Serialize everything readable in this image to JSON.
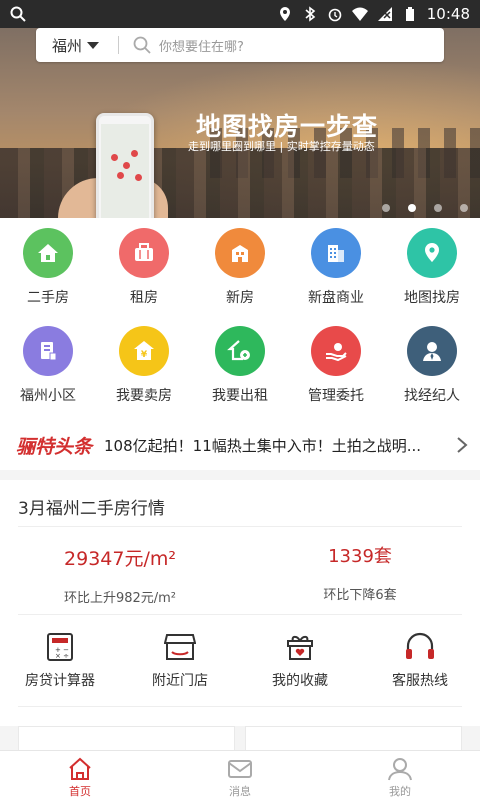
{
  "status_bar": {
    "time": "10:48"
  },
  "search": {
    "city": "福州",
    "placeholder": "你想要住在哪?"
  },
  "banner": {
    "title": "地图找房一步查",
    "subtitle": "走到哪里圈到哪里 | 实时掌控存量动态",
    "slide_count": 4,
    "active_slide": 2
  },
  "grid": {
    "row1": [
      {
        "label": "二手房",
        "icon": "house-icon",
        "color": "#5cc25f"
      },
      {
        "label": "租房",
        "icon": "suitcase-icon",
        "color": "#f06a6a"
      },
      {
        "label": "新房",
        "icon": "building-icon",
        "color": "#f08a3c"
      },
      {
        "label": "新盘商业",
        "icon": "office-icon",
        "color": "#4a90e2"
      },
      {
        "label": "地图找房",
        "icon": "map-pin-icon",
        "color": "#2ec4a6"
      }
    ],
    "row2": [
      {
        "label": "福州小区",
        "icon": "community-icon",
        "color": "#8a7ce0"
      },
      {
        "label": "我要卖房",
        "icon": "sell-icon",
        "color": "#f5c518"
      },
      {
        "label": "我要出租",
        "icon": "rent-out-icon",
        "color": "#2eb85c"
      },
      {
        "label": "管理委托",
        "icon": "hand-icon",
        "color": "#e84a4a"
      },
      {
        "label": "找经纪人",
        "icon": "agent-icon",
        "color": "#3e5f7a"
      }
    ]
  },
  "headline": {
    "logo": "骊特头条",
    "text": "108亿起拍！11幅热土集中入市！土拍之战明..."
  },
  "market": {
    "title": "3月福州二手房行情",
    "price": "29347元/m²",
    "price_change": "环比上升982元/m²",
    "listings": "1339套",
    "listings_change": "环比下降6套"
  },
  "tools": [
    {
      "label": "房贷计算器",
      "icon": "calculator-icon"
    },
    {
      "label": "附近门店",
      "icon": "store-icon"
    },
    {
      "label": "我的收藏",
      "icon": "gift-heart-icon"
    },
    {
      "label": "客服热线",
      "icon": "headset-icon"
    }
  ],
  "bottom_nav": [
    {
      "label": "首页",
      "icon": "home-icon",
      "active": true
    },
    {
      "label": "消息",
      "icon": "message-icon",
      "active": false
    },
    {
      "label": "我的",
      "icon": "profile-icon",
      "active": false
    }
  ],
  "colors": {
    "brand_red": "#d32f2f",
    "price_red": "#c62828"
  }
}
